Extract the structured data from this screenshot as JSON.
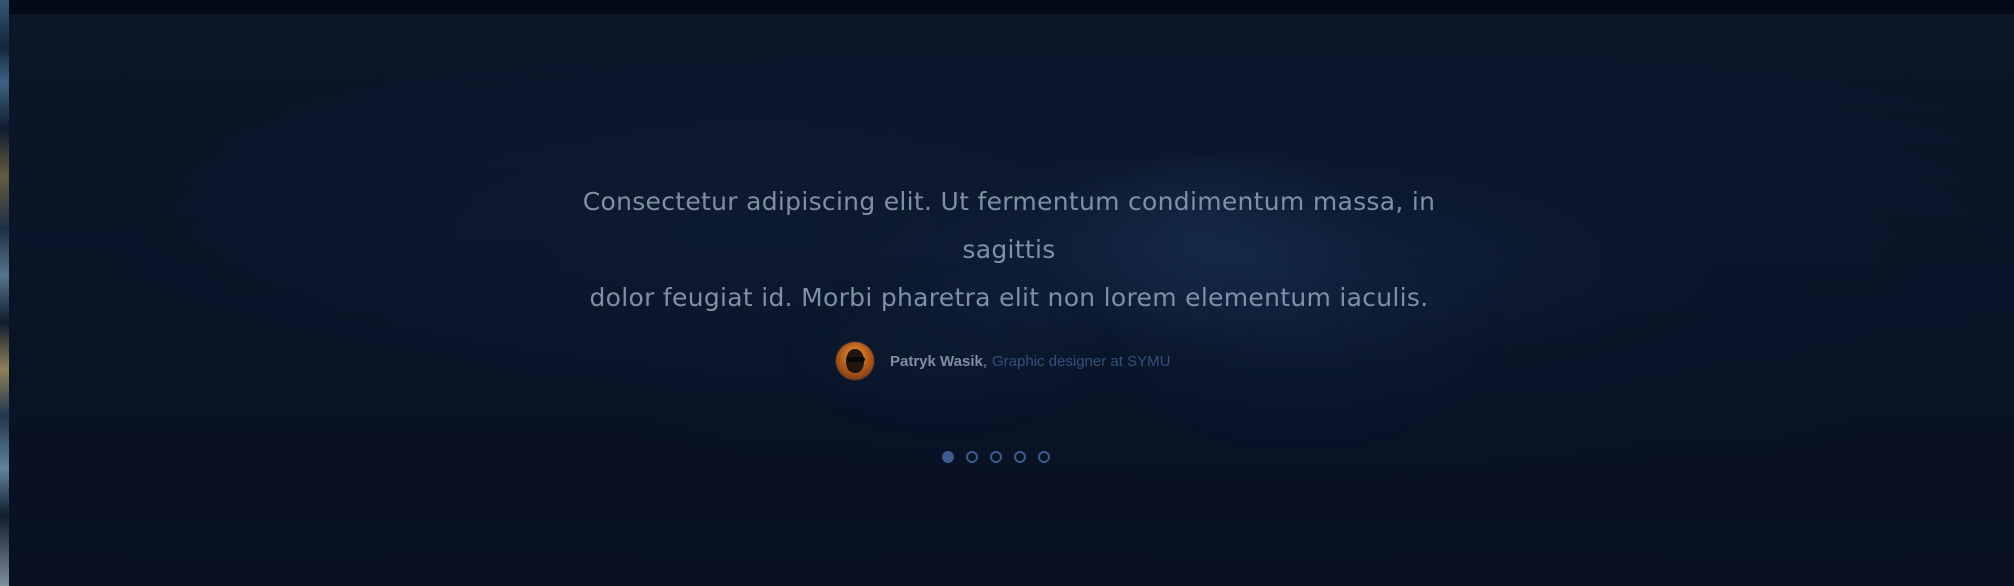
{
  "testimonial": {
    "quote_line_1": "Consectetur adipiscing elit. Ut fermentum condimentum massa, in sagittis",
    "quote_line_2": "dolor feugiat id. Morbi pharetra elit non lorem elementum iaculis.",
    "author_name": "Patryk Wasik",
    "author_separator": ",",
    "author_role": "Graphic designer at SYMU"
  },
  "pagination": {
    "active_index": 0,
    "count": 5
  },
  "colors": {
    "background": "#091427",
    "quote_text": "#7f8fa7",
    "author_name": "#7f8ea1",
    "author_role": "#34507c",
    "dot": "#3c5c8d"
  },
  "icons": {
    "avatar": "profile-photo"
  }
}
